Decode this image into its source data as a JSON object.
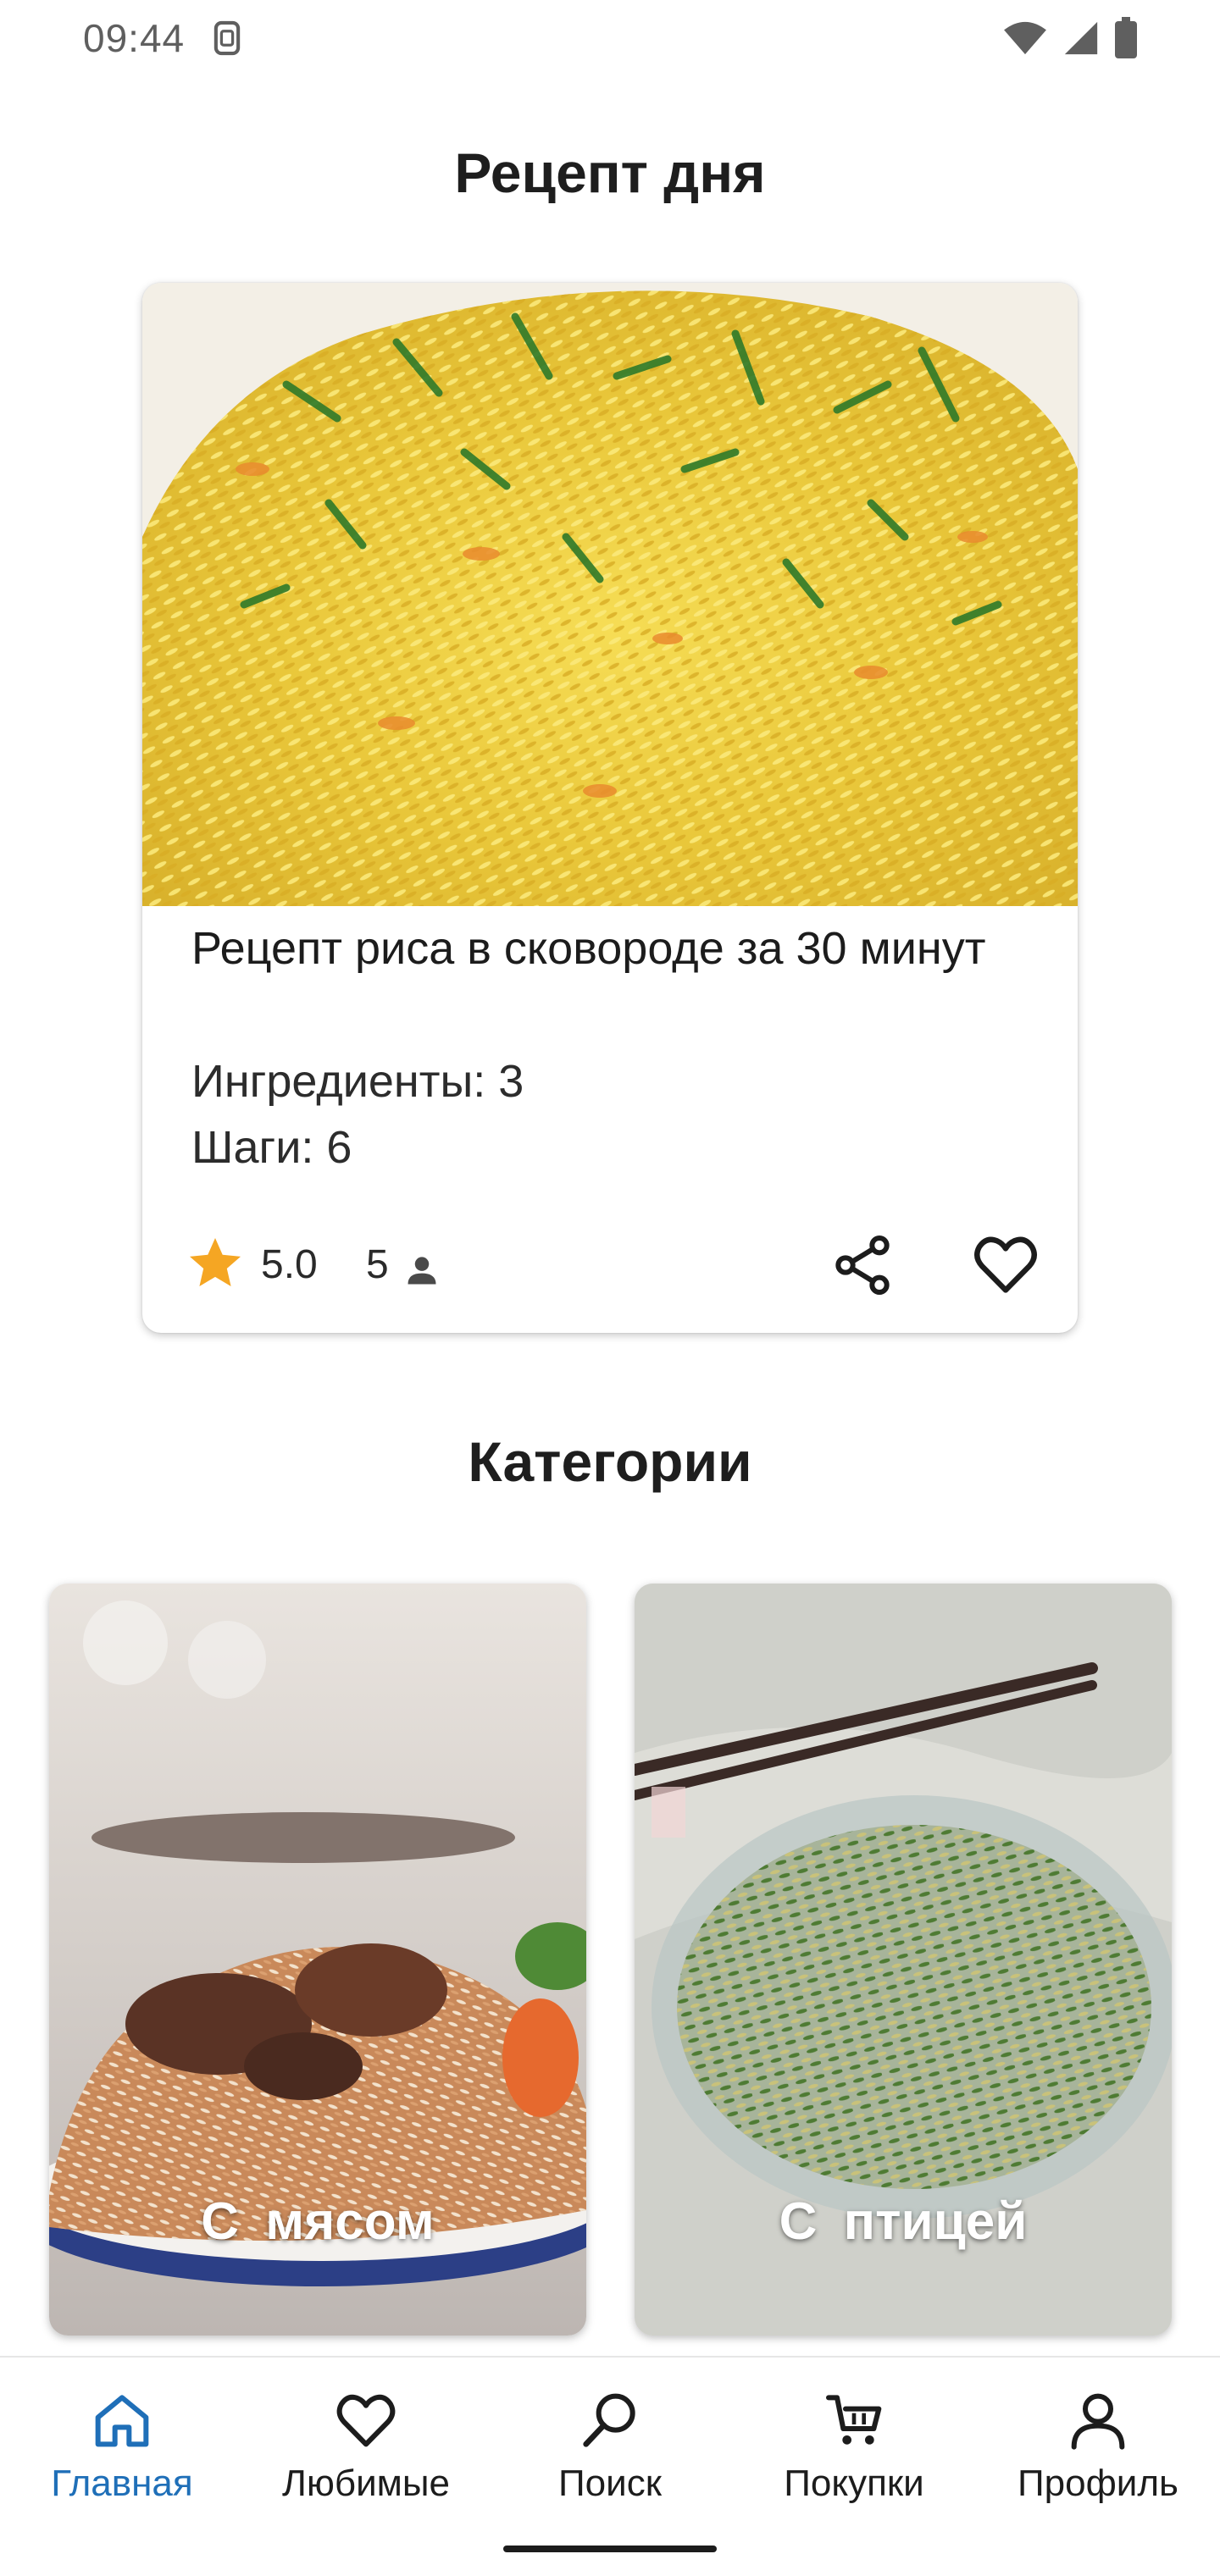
{
  "status_bar": {
    "time": "09:44",
    "left_icon": "sim-icon",
    "right_icons": [
      "wifi-icon",
      "signal-icon",
      "battery-icon"
    ]
  },
  "recipe_of_day": {
    "section_title": "Рецепт дня",
    "image_icon": "fried-rice-photo",
    "title": "Рецепт риса в сковороде за 30 минут",
    "ingredients": "Ингредиенты: 3",
    "steps": "Шаги: 6",
    "rating": "5.0",
    "reviews": "5",
    "actions": [
      "share-icon",
      "heart-icon"
    ]
  },
  "categories": {
    "section_title": "Категории",
    "items": [
      {
        "label": "С мясом",
        "image_icon": "rice-with-meat-photo"
      },
      {
        "label": "С птицей",
        "image_icon": "rice-with-poultry-photo"
      }
    ]
  },
  "bottom_nav": {
    "items": [
      {
        "label": "Главная",
        "icon": "home-icon",
        "active": true
      },
      {
        "label": "Любимые",
        "icon": "heart-icon",
        "active": false
      },
      {
        "label": "Поиск",
        "icon": "search-icon",
        "active": false
      },
      {
        "label": "Покупки",
        "icon": "cart-icon",
        "active": false
      },
      {
        "label": "Профиль",
        "icon": "profile-icon",
        "active": false
      }
    ]
  },
  "colors": {
    "accent": "#1f6fb8",
    "star": "#f5a623",
    "text": "#1c1c1c"
  }
}
